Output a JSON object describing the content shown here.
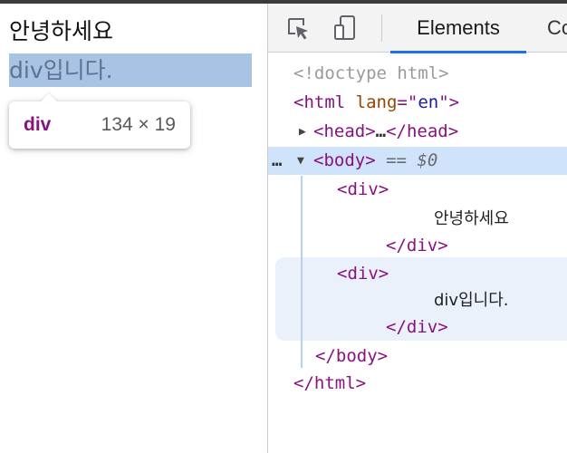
{
  "page": {
    "line1": "안녕하세요",
    "line2": "div입니다."
  },
  "tooltip": {
    "tag": "div",
    "size": "134 × 19"
  },
  "devtools": {
    "tabs": {
      "elements": "Elements",
      "console_partial": "Co"
    },
    "icons": {
      "inspect": "inspect-element-icon",
      "device": "device-toolbar-icon"
    },
    "tree": {
      "doctype": "<!doctype html>",
      "html_open_tag": "<html",
      "html_attr_name": "lang",
      "html_attr_eq": "=\"",
      "html_attr_value": "en",
      "html_attr_close": "\">",
      "head_open": "<head>",
      "head_ellipsis": "…",
      "head_close": "</head>",
      "row_dots": "…",
      "body_open": "<body>",
      "body_eq": "==",
      "body_var": "$0",
      "div1_open": "<div>",
      "div1_text": "안녕하세요",
      "div1_close": "</div>",
      "div2_open": "<div>",
      "div2_text": "div입니다.",
      "div2_close": "</div>",
      "body_close": "</body>",
      "html_close": "</html>"
    },
    "colors": {
      "tag": "#881280",
      "attr": "#994500",
      "value": "#1a1aa6",
      "selection": "#cfe3fa",
      "tab_underline": "#1a73e8"
    }
  }
}
